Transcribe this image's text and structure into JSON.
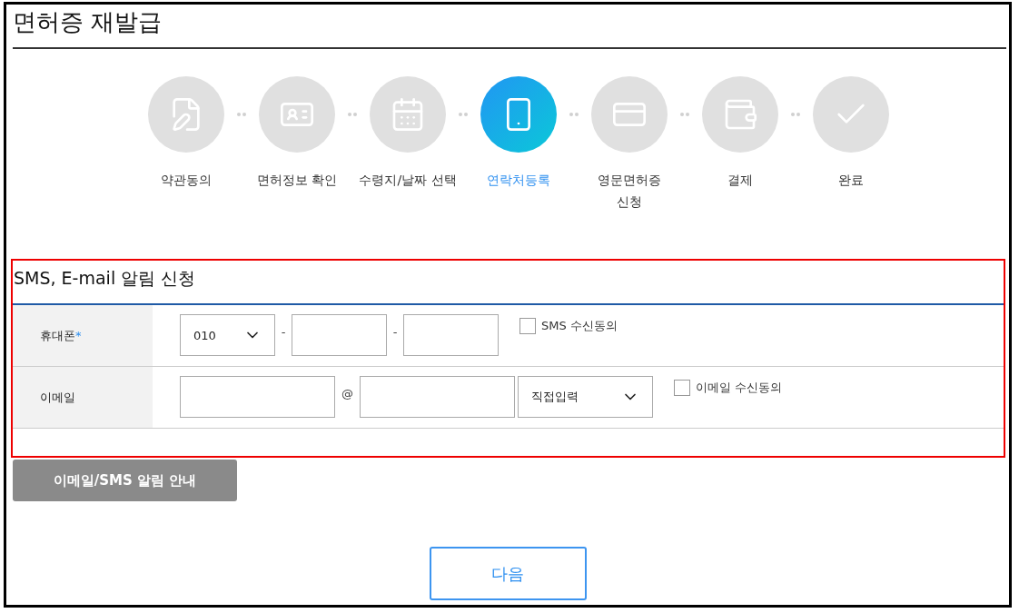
{
  "title": "면허증 재발급",
  "steps": [
    {
      "label": "약관동의",
      "selected": false
    },
    {
      "label": "면허정보 확인",
      "selected": false
    },
    {
      "label": "수령지/날짜 선택",
      "selected": false
    },
    {
      "label": "연락처등록",
      "selected": true
    },
    {
      "label": "영문면허증\n신청",
      "selected": false
    },
    {
      "label": "결제",
      "selected": false
    },
    {
      "label": "완료",
      "selected": false
    }
  ],
  "section": {
    "title": "SMS, E-mail 알림 신청",
    "phone": {
      "label": "휴대폰",
      "required_mark": "*",
      "prefix": "010",
      "separators": [
        "-",
        "-"
      ],
      "consent": {
        "label": "SMS 수신동의",
        "checked": false
      }
    },
    "email": {
      "label": "이메일",
      "at": "@",
      "domain_select": "직접입력",
      "consent": {
        "label": "이메일 수신동의",
        "checked": false
      }
    }
  },
  "info_button": "이메일/SMS 알림 안내",
  "next_button": "다음"
}
